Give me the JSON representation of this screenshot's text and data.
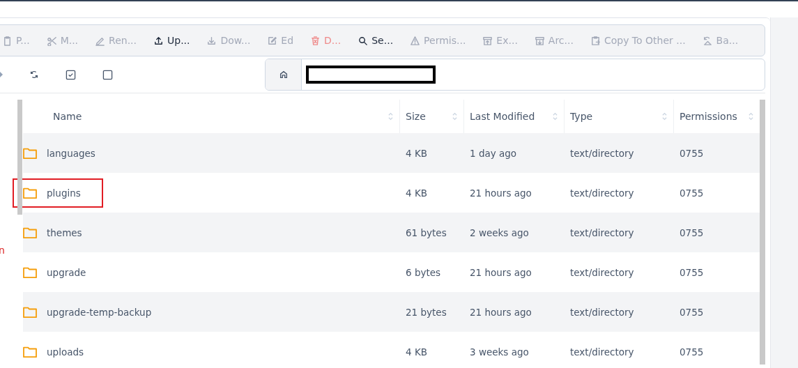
{
  "toolbar": [
    {
      "label": "P...",
      "disabled": true,
      "danger": false
    },
    {
      "label": "M...",
      "disabled": true,
      "danger": false
    },
    {
      "label": "Ren...",
      "disabled": true,
      "danger": false
    },
    {
      "label": "Up...",
      "disabled": false,
      "danger": false
    },
    {
      "label": "Dow...",
      "disabled": true,
      "danger": false
    },
    {
      "label": "Ed",
      "disabled": true,
      "danger": false
    },
    {
      "label": "D...",
      "disabled": true,
      "danger": true
    },
    {
      "label": "Se...",
      "disabled": false,
      "danger": false
    },
    {
      "label": "Permis...",
      "disabled": true,
      "danger": false
    },
    {
      "label": "Ex...",
      "disabled": true,
      "danger": false
    },
    {
      "label": "Arc...",
      "disabled": true,
      "danger": false
    },
    {
      "label": "Copy To Other ...",
      "disabled": true,
      "danger": false
    },
    {
      "label": "Ba...",
      "disabled": true,
      "danger": false
    }
  ],
  "sidebar_fragment": "n",
  "table": {
    "columns": [
      "Name",
      "Size",
      "Last Modified",
      "Type",
      "Permissions"
    ],
    "rows": [
      {
        "name": "languages",
        "size": "4 KB",
        "modified": "1 day ago",
        "type": "text/directory",
        "permissions": "0755",
        "highlighted": false
      },
      {
        "name": "plugins",
        "size": "4 KB",
        "modified": "21 hours ago",
        "type": "text/directory",
        "permissions": "0755",
        "highlighted": true
      },
      {
        "name": "themes",
        "size": "61 bytes",
        "modified": "2 weeks ago",
        "type": "text/directory",
        "permissions": "0755",
        "highlighted": false
      },
      {
        "name": "upgrade",
        "size": "6 bytes",
        "modified": "21 hours ago",
        "type": "text/directory",
        "permissions": "0755",
        "highlighted": false
      },
      {
        "name": "upgrade-temp-backup",
        "size": "21 bytes",
        "modified": "21 hours ago",
        "type": "text/directory",
        "permissions": "0755",
        "highlighted": false
      },
      {
        "name": "uploads",
        "size": "4 KB",
        "modified": "3 weeks ago",
        "type": "text/directory",
        "permissions": "0755",
        "highlighted": false
      }
    ]
  }
}
